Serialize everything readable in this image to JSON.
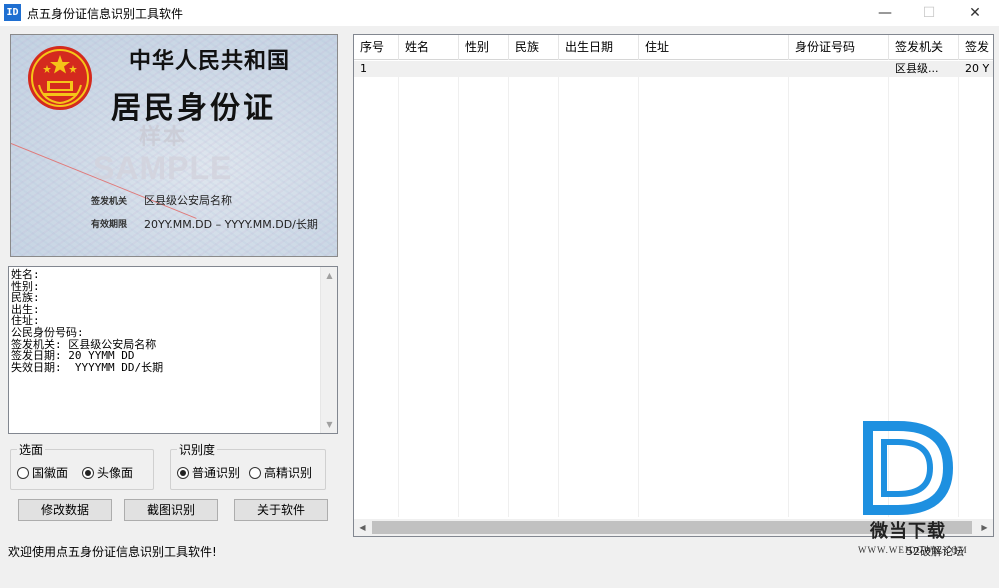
{
  "window": {
    "icon_text": "ID",
    "title": "点五身份证信息识别工具软件",
    "min_glyph": "—",
    "max_glyph": "☐",
    "close_glyph": "✕"
  },
  "card": {
    "line1": "中华人民共和国",
    "line2": "居民身份证",
    "watermark_cn": "样本",
    "watermark_en": "SAMPLE",
    "authority_label": "签发机关",
    "authority_value": "区县级公安局名称",
    "validity_label": "有效期限",
    "validity_value": "20YY.MM.DD – YYYY.MM.DD/长期"
  },
  "result_text": {
    "lines": [
      "姓名:",
      "性别:",
      "民族:",
      "出生:",
      "住址:",
      "公民身份号码:",
      "签发机关: 区县级公安局名称",
      "签发日期: 20 YYMM DD",
      "失效日期:  YYYYMM DD/长期"
    ]
  },
  "side_group": {
    "title": "选面",
    "options": [
      "国徽面",
      "头像面"
    ],
    "selected": "头像面"
  },
  "level_group": {
    "title": "识别度",
    "options": [
      "普通识别",
      "高精识别"
    ],
    "selected": "普通识别"
  },
  "buttons": {
    "edit": "修改数据",
    "screenshot": "截图识别",
    "about": "关于软件"
  },
  "table": {
    "columns": [
      "序号",
      "姓名",
      "性别",
      "民族",
      "出生日期",
      "住址",
      "身份证号码",
      "签发机关",
      "签发"
    ],
    "rows": [
      [
        "1",
        "",
        "",
        "",
        "",
        "",
        "",
        "区县级...",
        "20 Y"
      ]
    ]
  },
  "logo": {
    "cn": "微当下载",
    "url": "WWW.WEIDOWN.COM",
    "forum": "52破解论坛"
  },
  "status": "欢迎使用点五身份证信息识别工具软件!",
  "colors": {
    "logo_blue": "#1e90e0",
    "emblem_red": "#d42a1e",
    "emblem_gold": "#f5c518"
  }
}
